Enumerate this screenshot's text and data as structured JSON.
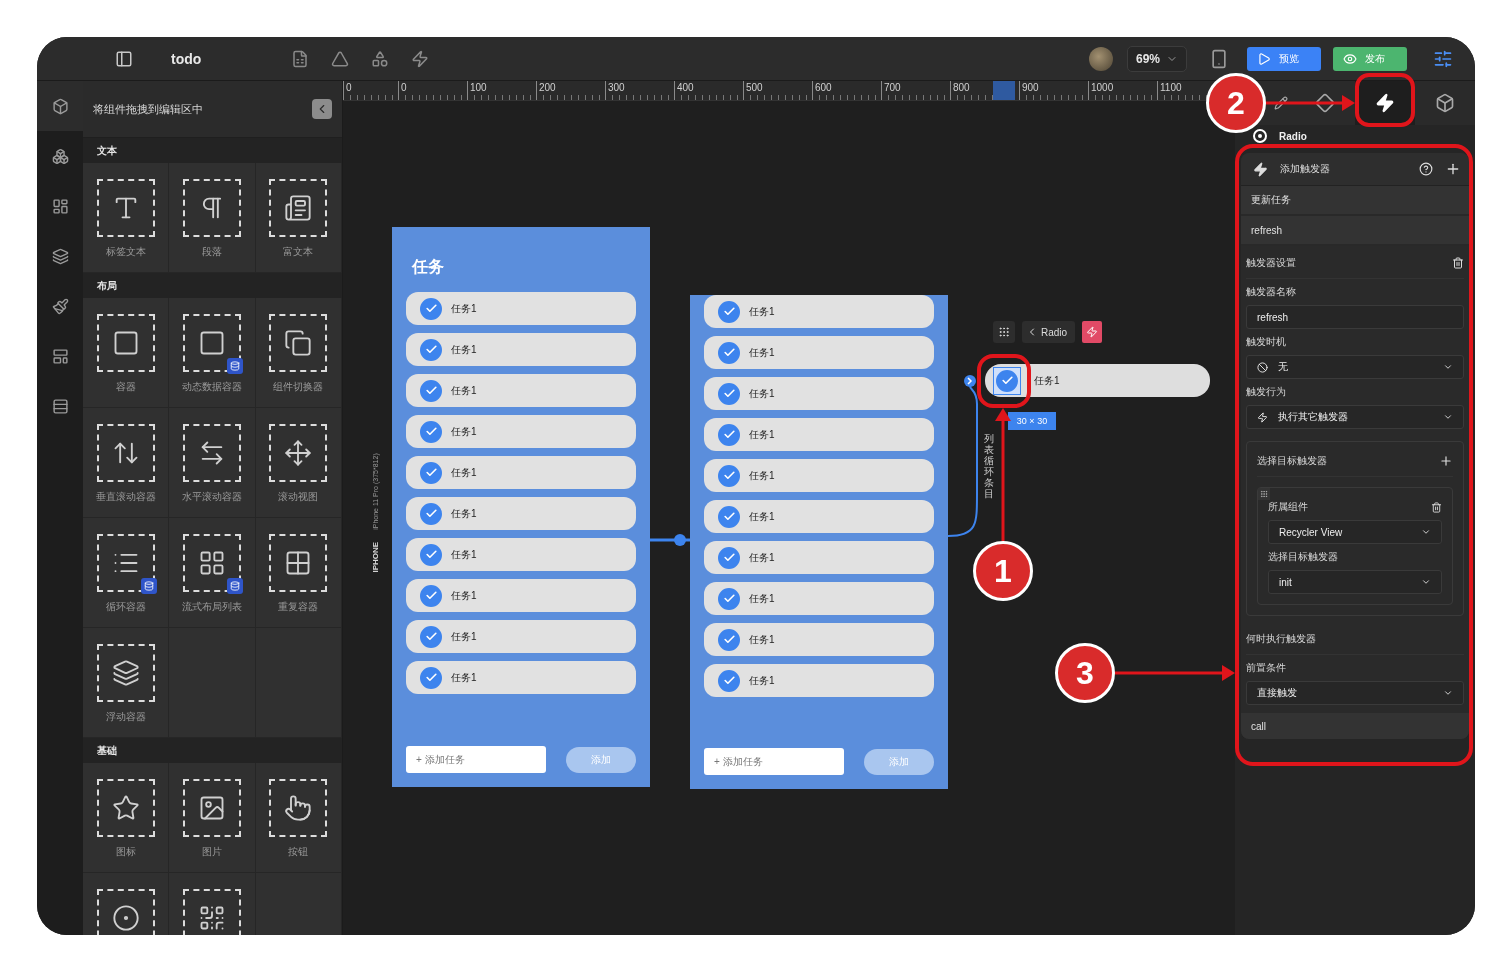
{
  "toolbar": {
    "title": "todo",
    "zoom": "69%",
    "preview_button": "预览",
    "publish_button": "发布"
  },
  "rail": [
    {
      "selected": true
    },
    {
      "selected": false
    },
    {
      "selected": false
    },
    {
      "selected": false
    },
    {
      "selected": false
    },
    {
      "selected": false
    },
    {
      "selected": false
    }
  ],
  "component_panel": {
    "hint": "将组件拖拽到编辑区中",
    "sections": [
      {
        "title": "文本",
        "items": [
          {
            "label": "标签文本"
          },
          {
            "label": "段落"
          },
          {
            "label": "富文本"
          }
        ]
      },
      {
        "title": "布局",
        "items": [
          {
            "label": "容器"
          },
          {
            "label": "动态数据容器"
          },
          {
            "label": "组件切换器"
          },
          {
            "label": "垂直滚动容器"
          },
          {
            "label": "水平滚动容器"
          },
          {
            "label": "滚动视图"
          },
          {
            "label": "循环容器"
          },
          {
            "label": "流式布局列表"
          },
          {
            "label": "重复容器"
          },
          {
            "label": "浮动容器"
          }
        ]
      },
      {
        "title": "基础",
        "items": [
          {
            "label": "图标"
          },
          {
            "label": "图片"
          },
          {
            "label": "按钮"
          },
          {
            "cut": true
          },
          {
            "cut": true
          }
        ]
      }
    ]
  },
  "canvas": {
    "ruler": [
      "0",
      "0",
      "100",
      "200",
      "300",
      "400",
      "500",
      "600",
      "700",
      "800",
      "900",
      "1000",
      "1100"
    ],
    "device": {
      "name": "IPHONE",
      "model": "iPhone 11 Pro (375*812)"
    },
    "frames": [
      {
        "title": "任务",
        "rows": [
          {
            "label": "任务1",
            "checked": true
          },
          {
            "label": "任务1",
            "checked": true
          },
          {
            "label": "任务1",
            "checked": true
          },
          {
            "label": "任务1",
            "checked": true
          },
          {
            "label": "任务1",
            "checked": true
          },
          {
            "label": "任务1",
            "checked": true
          },
          {
            "label": "任务1",
            "checked": true
          },
          {
            "label": "任务1",
            "checked": true
          },
          {
            "label": "任务1",
            "checked": true
          },
          {
            "label": "任务1",
            "checked": true
          }
        ],
        "placeholder": "+ 添加任务",
        "button": "添加"
      },
      {
        "rows": [
          {
            "label": "任务1",
            "checked": true
          },
          {
            "label": "任务1",
            "checked": true
          },
          {
            "label": "任务1",
            "checked": true
          },
          {
            "label": "任务1",
            "checked": true
          },
          {
            "label": "任务1",
            "checked": true
          },
          {
            "label": "任务1",
            "checked": true
          },
          {
            "label": "任务1",
            "checked": true
          },
          {
            "label": "任务1",
            "checked": true
          },
          {
            "label": "任务1",
            "checked": true
          },
          {
            "label": "任务1",
            "checked": true
          }
        ],
        "placeholder": "+ 添加任务",
        "button": "添加"
      }
    ],
    "selected_item": {
      "toolbar_label": "Radio",
      "label": "任务1",
      "checked": true,
      "size": "30 × 30"
    },
    "connector_label": "列表循环条目"
  },
  "inspector": {
    "tabs": [
      {
        "selected": false
      },
      {
        "selected": false
      },
      {
        "selected": true
      },
      {
        "selected": false
      }
    ],
    "component": "Radio",
    "trigger": {
      "header": "添加触发器",
      "triggers": [
        "更新任务",
        "refresh"
      ],
      "settings_title": "触发器设置",
      "fields": [
        {
          "label": "触发器名称",
          "value": "refresh",
          "kind": "input"
        },
        {
          "label": "触发时机",
          "value": "无",
          "kind": "select"
        },
        {
          "label": "触发行为",
          "value": "执行其它触发器",
          "kind": "select"
        }
      ],
      "target": {
        "title": "选择目标触发器",
        "component_label": "所属组件",
        "component_value": "Recycler View",
        "trigger_label": "选择目标触发器",
        "trigger_value": "init"
      },
      "when_title": "何时执行触发器",
      "condition_label": "前置条件",
      "condition_value": "直接触发",
      "footer": "call"
    }
  },
  "annotations": [
    {
      "label": "1"
    },
    {
      "label": "2"
    },
    {
      "label": "3"
    }
  ]
}
